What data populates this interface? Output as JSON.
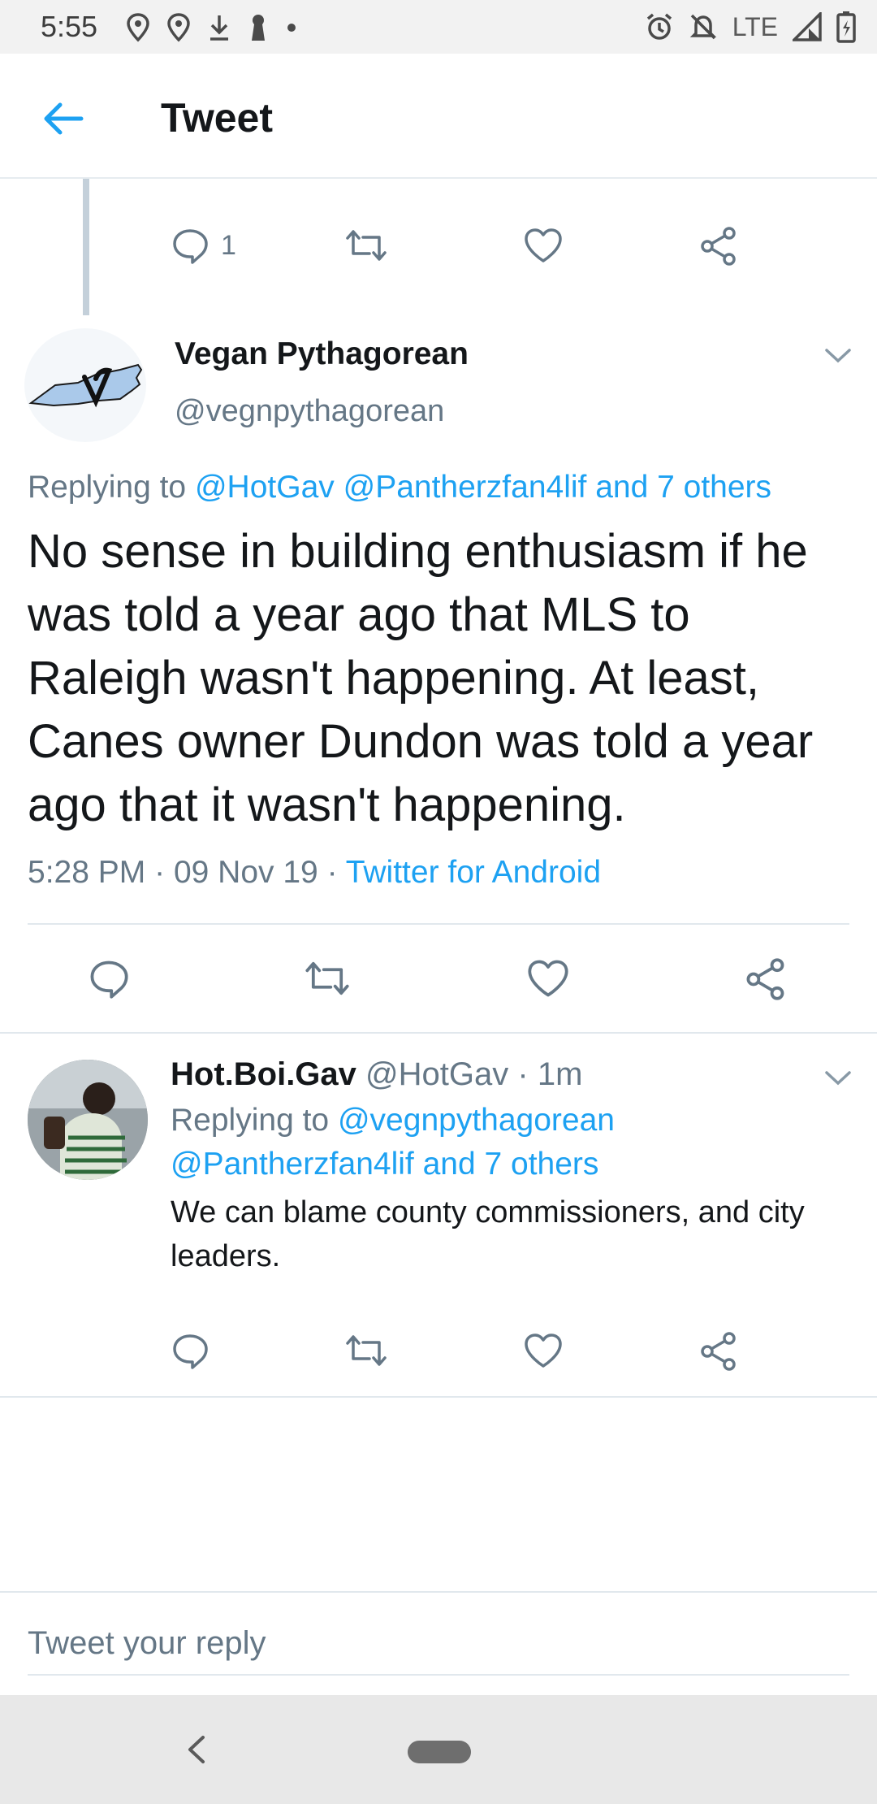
{
  "status_bar": {
    "time": "5:55",
    "network": "LTE",
    "left_icons": [
      "location-pin-icon",
      "location-pin-icon",
      "download-icon",
      "keyhole-icon",
      "dot-icon"
    ],
    "right_icons": [
      "alarm-icon",
      "notifications-off-icon",
      "signal-icon",
      "battery-charging-icon"
    ]
  },
  "header": {
    "title": "Tweet"
  },
  "parent_tweet_actions": {
    "reply_count": "1"
  },
  "main_tweet": {
    "display_name": "Vegan Pythagorean",
    "handle": "@vegnpythagorean",
    "replying_label": "Replying to",
    "replying_mentions": "@HotGav @Pantherzfan4lif and 7 others",
    "text": "No sense in building enthusiasm if he was told a year ago that MLS to Raleigh wasn't happening. At least, Canes owner Dundon was told a year ago that it wasn't happening.",
    "time": "5:28 PM",
    "date": "09 Nov 19",
    "sep": "·",
    "source": "Twitter for Android"
  },
  "reply_tweet": {
    "display_name": "Hot.Boi.Gav",
    "handle": "@HotGav",
    "age": "1m",
    "sep": "·",
    "replying_label": "Replying to",
    "replying_mention_1": "@vegnpythagorean",
    "replying_mention_2": "@Pantherzfan4lif and 7 others",
    "text": "We can blame county commissioners, and city leaders."
  },
  "reply_composer": {
    "placeholder": "Tweet your reply"
  },
  "colors": {
    "accent": "#1da1f2",
    "secondary_text": "#657786",
    "primary_text": "#14171a",
    "divider": "#e1e8ed"
  }
}
